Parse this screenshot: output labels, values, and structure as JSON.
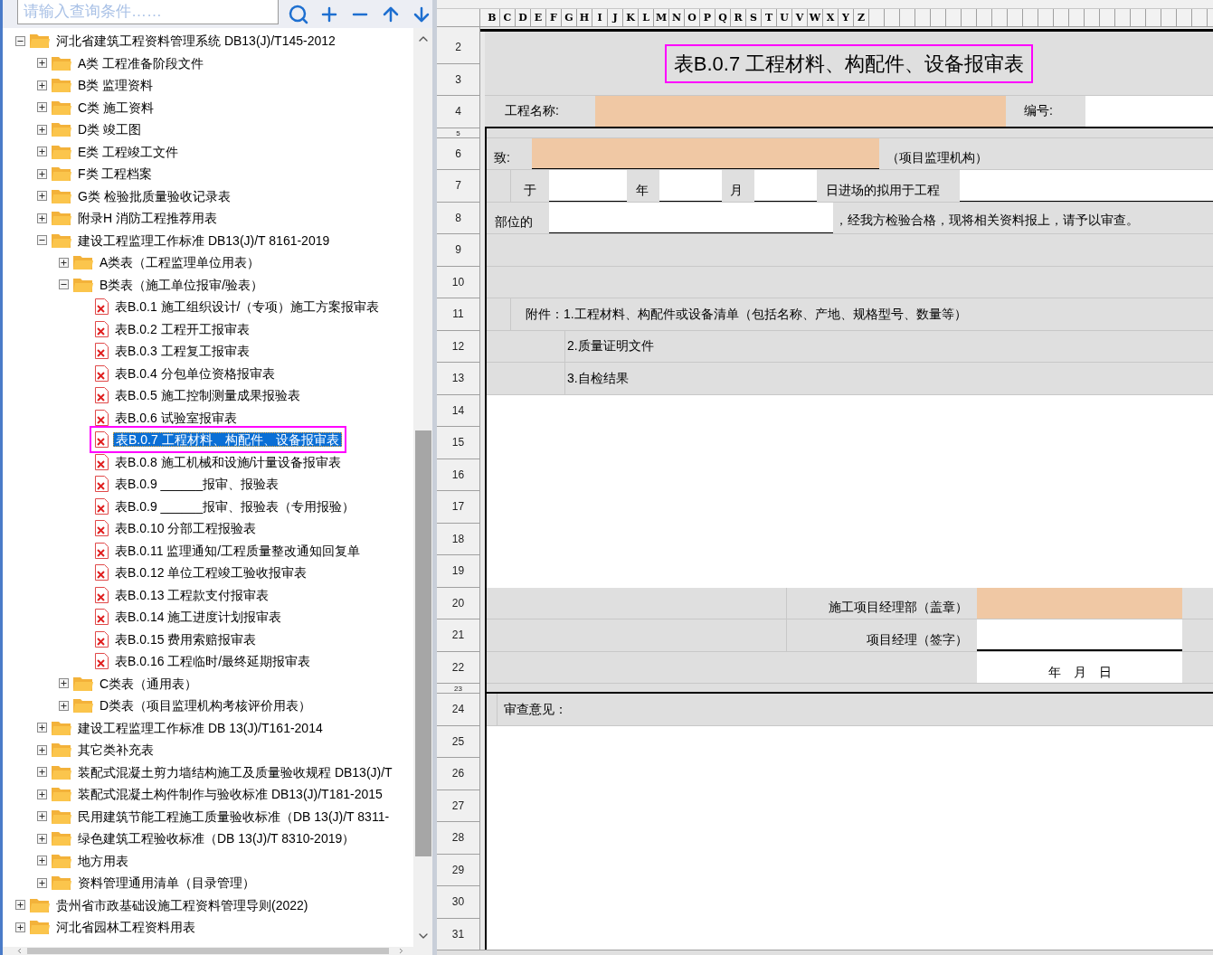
{
  "search": {
    "placeholder": "请输入查询条件……"
  },
  "tree": [
    {
      "label": "河北省建筑工程资料管理系统 DB13(J)/T145-2012",
      "kind": "folder",
      "expanded": true,
      "selected": false,
      "children": [
        {
          "label": "A类 工程准备阶段文件",
          "kind": "folder",
          "expanded": false,
          "selected": false
        },
        {
          "label": "B类 监理资料",
          "kind": "folder",
          "expanded": false,
          "selected": false
        },
        {
          "label": "C类 施工资料",
          "kind": "folder",
          "expanded": false,
          "selected": false
        },
        {
          "label": "D类 竣工图",
          "kind": "folder",
          "expanded": false,
          "selected": false
        },
        {
          "label": "E类 工程竣工文件",
          "kind": "folder",
          "expanded": false,
          "selected": false
        },
        {
          "label": "F类 工程档案",
          "kind": "folder",
          "expanded": false,
          "selected": false
        },
        {
          "label": "G类 检验批质量验收记录表",
          "kind": "folder",
          "expanded": false,
          "selected": false
        },
        {
          "label": "附录H 消防工程推荐用表",
          "kind": "folder",
          "expanded": false,
          "selected": false
        },
        {
          "label": "建设工程监理工作标准 DB13(J)/T 8161-2019",
          "kind": "folder",
          "expanded": true,
          "selected": false,
          "children": [
            {
              "label": "A类表（工程监理单位用表）",
              "kind": "folder",
              "expanded": false,
              "selected": false
            },
            {
              "label": "B类表（施工单位报审/验表）",
              "kind": "folder",
              "expanded": true,
              "selected": false,
              "children": [
                {
                  "label": "表B.0.1 施工组织设计/（专项）施工方案报审表",
                  "kind": "file",
                  "selected": false
                },
                {
                  "label": "表B.0.2 工程开工报审表",
                  "kind": "file",
                  "selected": false
                },
                {
                  "label": "表B.0.3 工程复工报审表",
                  "kind": "file",
                  "selected": false
                },
                {
                  "label": "表B.0.4 分包单位资格报审表",
                  "kind": "file",
                  "selected": false
                },
                {
                  "label": "表B.0.5 施工控制测量成果报验表",
                  "kind": "file",
                  "selected": false
                },
                {
                  "label": "表B.0.6 试验室报审表",
                  "kind": "file",
                  "selected": false
                },
                {
                  "label": "表B.0.7 工程材料、构配件、设备报审表",
                  "kind": "file",
                  "selected": true
                },
                {
                  "label": "表B.0.8 施工机械和设施/计量设备报审表",
                  "kind": "file",
                  "selected": false
                },
                {
                  "label": "表B.0.9 ______报审、报验表",
                  "kind": "file",
                  "selected": false
                },
                {
                  "label": "表B.0.9 ______报审、报验表（专用报验）",
                  "kind": "file",
                  "selected": false
                },
                {
                  "label": "表B.0.10 分部工程报验表",
                  "kind": "file",
                  "selected": false
                },
                {
                  "label": "表B.0.11 监理通知/工程质量整改通知回复单",
                  "kind": "file",
                  "selected": false
                },
                {
                  "label": "表B.0.12 单位工程竣工验收报审表",
                  "kind": "file",
                  "selected": false
                },
                {
                  "label": "表B.0.13 工程款支付报审表",
                  "kind": "file",
                  "selected": false
                },
                {
                  "label": "表B.0.14 施工进度计划报审表",
                  "kind": "file",
                  "selected": false
                },
                {
                  "label": "表B.0.15 费用索赔报审表",
                  "kind": "file",
                  "selected": false
                },
                {
                  "label": "表B.0.16 工程临时/最终延期报审表",
                  "kind": "file",
                  "selected": false
                }
              ]
            },
            {
              "label": "C类表（通用表）",
              "kind": "folder",
              "expanded": false,
              "selected": false
            },
            {
              "label": "D类表（项目监理机构考核评价用表）",
              "kind": "folder",
              "expanded": false,
              "selected": false
            }
          ]
        },
        {
          "label": "建设工程监理工作标准 DB 13(J)/T161-2014",
          "kind": "folder",
          "expanded": false,
          "selected": false
        },
        {
          "label": "其它类补充表",
          "kind": "folder",
          "expanded": false,
          "selected": false
        },
        {
          "label": "装配式混凝土剪力墙结构施工及质量验收规程 DB13(J)/T",
          "kind": "folder",
          "expanded": false,
          "selected": false
        },
        {
          "label": "装配式混凝土构件制作与验收标准 DB13(J)/T181-2015",
          "kind": "folder",
          "expanded": false,
          "selected": false
        },
        {
          "label": "民用建筑节能工程施工质量验收标准（DB 13(J)/T 8311-",
          "kind": "folder",
          "expanded": false,
          "selected": false
        },
        {
          "label": "绿色建筑工程验收标准（DB 13(J)/T 8310-2019）",
          "kind": "folder",
          "expanded": false,
          "selected": false
        },
        {
          "label": "地方用表",
          "kind": "folder",
          "expanded": false,
          "selected": false
        },
        {
          "label": "资料管理通用清单（目录管理）",
          "kind": "folder",
          "expanded": false,
          "selected": false
        }
      ]
    },
    {
      "label": "贵州省市政基础设施工程资料管理导则(2022)",
      "kind": "folder",
      "expanded": false,
      "selected": false
    },
    {
      "label": "河北省园林工程资料用表",
      "kind": "folder",
      "expanded": false,
      "selected": false
    }
  ],
  "sheet": {
    "column_headers": [
      "B",
      "C",
      "D",
      "E",
      "F",
      "G",
      "H",
      "I",
      "J",
      "K",
      "L",
      "M",
      "N",
      "O",
      "P",
      "Q",
      "R",
      "S",
      "T",
      "U",
      "V",
      "W",
      "X",
      "Y",
      "Z"
    ],
    "row_numbers": [
      {
        "label": "2",
        "kind": "normal"
      },
      {
        "label": "3",
        "kind": "normal"
      },
      {
        "label": "4",
        "kind": "normal"
      },
      {
        "label": "5",
        "kind": "thin"
      },
      {
        "label": "6",
        "kind": "normal"
      },
      {
        "label": "7",
        "kind": "normal"
      },
      {
        "label": "8",
        "kind": "normal"
      },
      {
        "label": "9",
        "kind": "normal"
      },
      {
        "label": "10",
        "kind": "normal"
      },
      {
        "label": "11",
        "kind": "normal"
      },
      {
        "label": "12",
        "kind": "normal"
      },
      {
        "label": "13",
        "kind": "normal"
      },
      {
        "label": "14",
        "kind": "normal"
      },
      {
        "label": "15",
        "kind": "normal"
      },
      {
        "label": "16",
        "kind": "normal"
      },
      {
        "label": "17",
        "kind": "normal"
      },
      {
        "label": "18",
        "kind": "normal"
      },
      {
        "label": "19",
        "kind": "normal"
      },
      {
        "label": "20",
        "kind": "normal"
      },
      {
        "label": "21",
        "kind": "normal"
      },
      {
        "label": "22",
        "kind": "normal"
      },
      {
        "label": "23",
        "kind": "thin"
      },
      {
        "label": "24",
        "kind": "normal"
      },
      {
        "label": "25",
        "kind": "normal"
      },
      {
        "label": "26",
        "kind": "normal"
      },
      {
        "label": "27",
        "kind": "normal"
      },
      {
        "label": "28",
        "kind": "normal"
      },
      {
        "label": "29",
        "kind": "normal"
      },
      {
        "label": "30",
        "kind": "normal"
      },
      {
        "label": "31",
        "kind": "normal"
      }
    ],
    "form": {
      "title": "表B.0.7 工程材料、构配件、设备报审表",
      "title_outlined": true,
      "project_name_label": "工程名称:",
      "number_label": "编号:",
      "to_label": "致:",
      "to_suffix": "（项目监理机构）",
      "date_words": [
        "于",
        "年",
        "月",
        "日进场的拟用于工程"
      ],
      "position_label": "部位的",
      "statement": "，经我方检验合格，现将相关资料报上，请予以审查。",
      "attachments": [
        "附件：1.工程材料、构配件或设备清单（包括名称、产地、规格型号、数量等）",
        "2.质量证明文件",
        "3.自检结果"
      ],
      "seal_label": "施工项目经理部（盖章）",
      "manager_label": "项目经理（签字）",
      "date_line": "年　月　日",
      "review_label": "审查意见："
    }
  }
}
